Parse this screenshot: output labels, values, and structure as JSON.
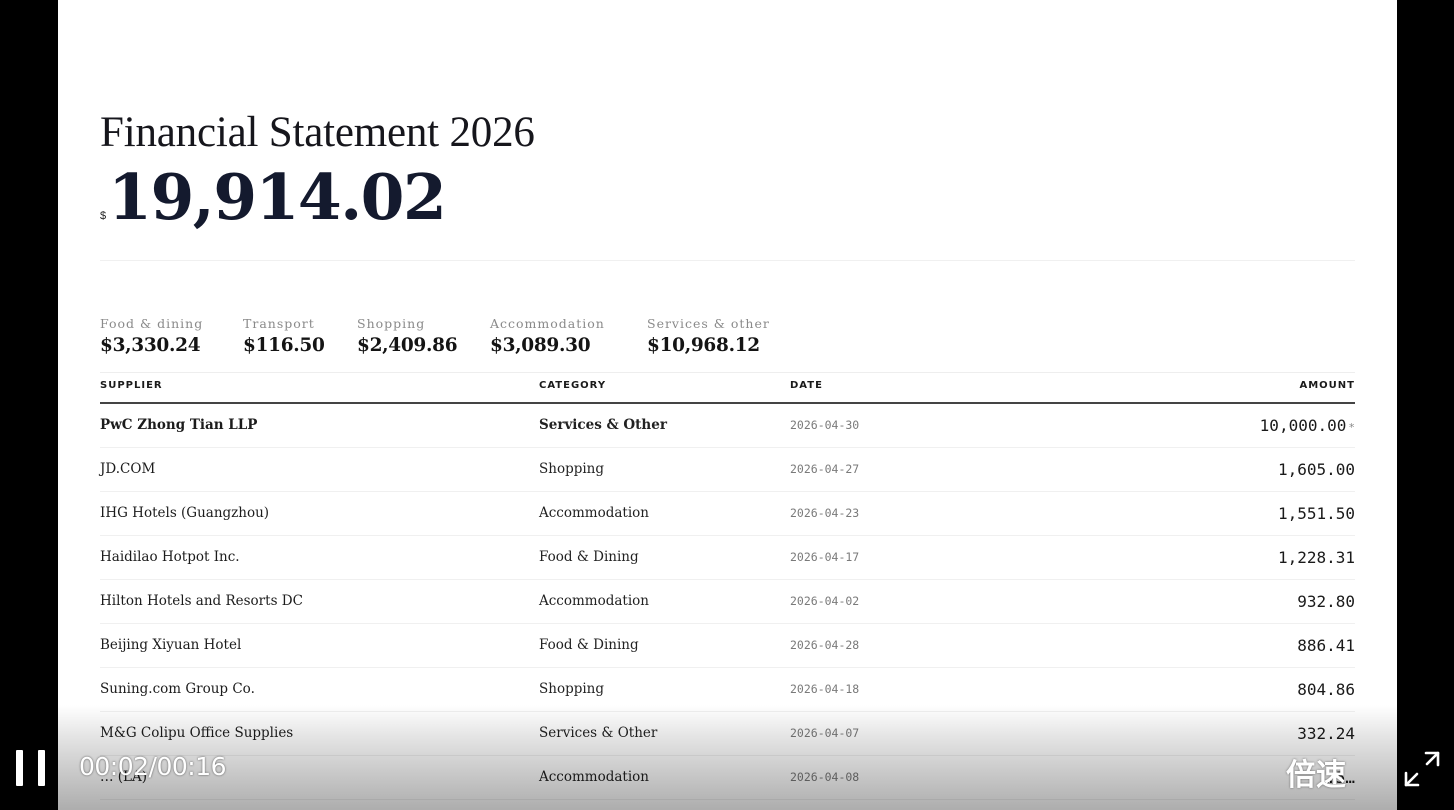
{
  "statement": {
    "title": "Financial Statement 2026",
    "currency_symbol": "$",
    "total": "19,914.02"
  },
  "categories": [
    {
      "label": "Food & dining",
      "value": "$3,330.24"
    },
    {
      "label": "Transport",
      "value": "$116.50"
    },
    {
      "label": "Shopping",
      "value": "$2,409.86"
    },
    {
      "label": "Accommodation",
      "value": "$3,089.30"
    },
    {
      "label": "Services & other",
      "value": "$10,968.12"
    }
  ],
  "table": {
    "headers": {
      "supplier": "SUPPLIER",
      "category": "CATEGORY",
      "date": "DATE",
      "amount": "AMOUNT"
    },
    "rows": [
      {
        "supplier": "PwC Zhong Tian LLP",
        "category": "Services & Other",
        "date": "2026-04-30",
        "amount": "10,000.00",
        "marker": "*"
      },
      {
        "supplier": "JD.COM",
        "category": "Shopping",
        "date": "2026-04-27",
        "amount": "1,605.00"
      },
      {
        "supplier": "IHG Hotels (Guangzhou)",
        "category": "Accommodation",
        "date": "2026-04-23",
        "amount": "1,551.50"
      },
      {
        "supplier": "Haidilao Hotpot Inc.",
        "category": "Food & Dining",
        "date": "2026-04-17",
        "amount": "1,228.31"
      },
      {
        "supplier": "Hilton Hotels and Resorts DC",
        "category": "Accommodation",
        "date": "2026-04-02",
        "amount": "932.80"
      },
      {
        "supplier": "Beijing Xiyuan Hotel",
        "category": "Food & Dining",
        "date": "2026-04-28",
        "amount": "886.41"
      },
      {
        "supplier": "Suning.com Group Co.",
        "category": "Shopping",
        "date": "2026-04-18",
        "amount": "804.86"
      },
      {
        "supplier": "M&G Colipu Office Supplies",
        "category": "Services & Other",
        "date": "2026-04-07",
        "amount": "332.24"
      },
      {
        "supplier": "… (LA)",
        "category": "Accommodation",
        "date": "2026-04-08",
        "amount": "…5…"
      }
    ]
  },
  "player": {
    "time": "00:02/00:16",
    "speed_label": "倍速",
    "pause_icon": "pause-icon",
    "fullscreen_icon": "fullscreen-icon"
  }
}
